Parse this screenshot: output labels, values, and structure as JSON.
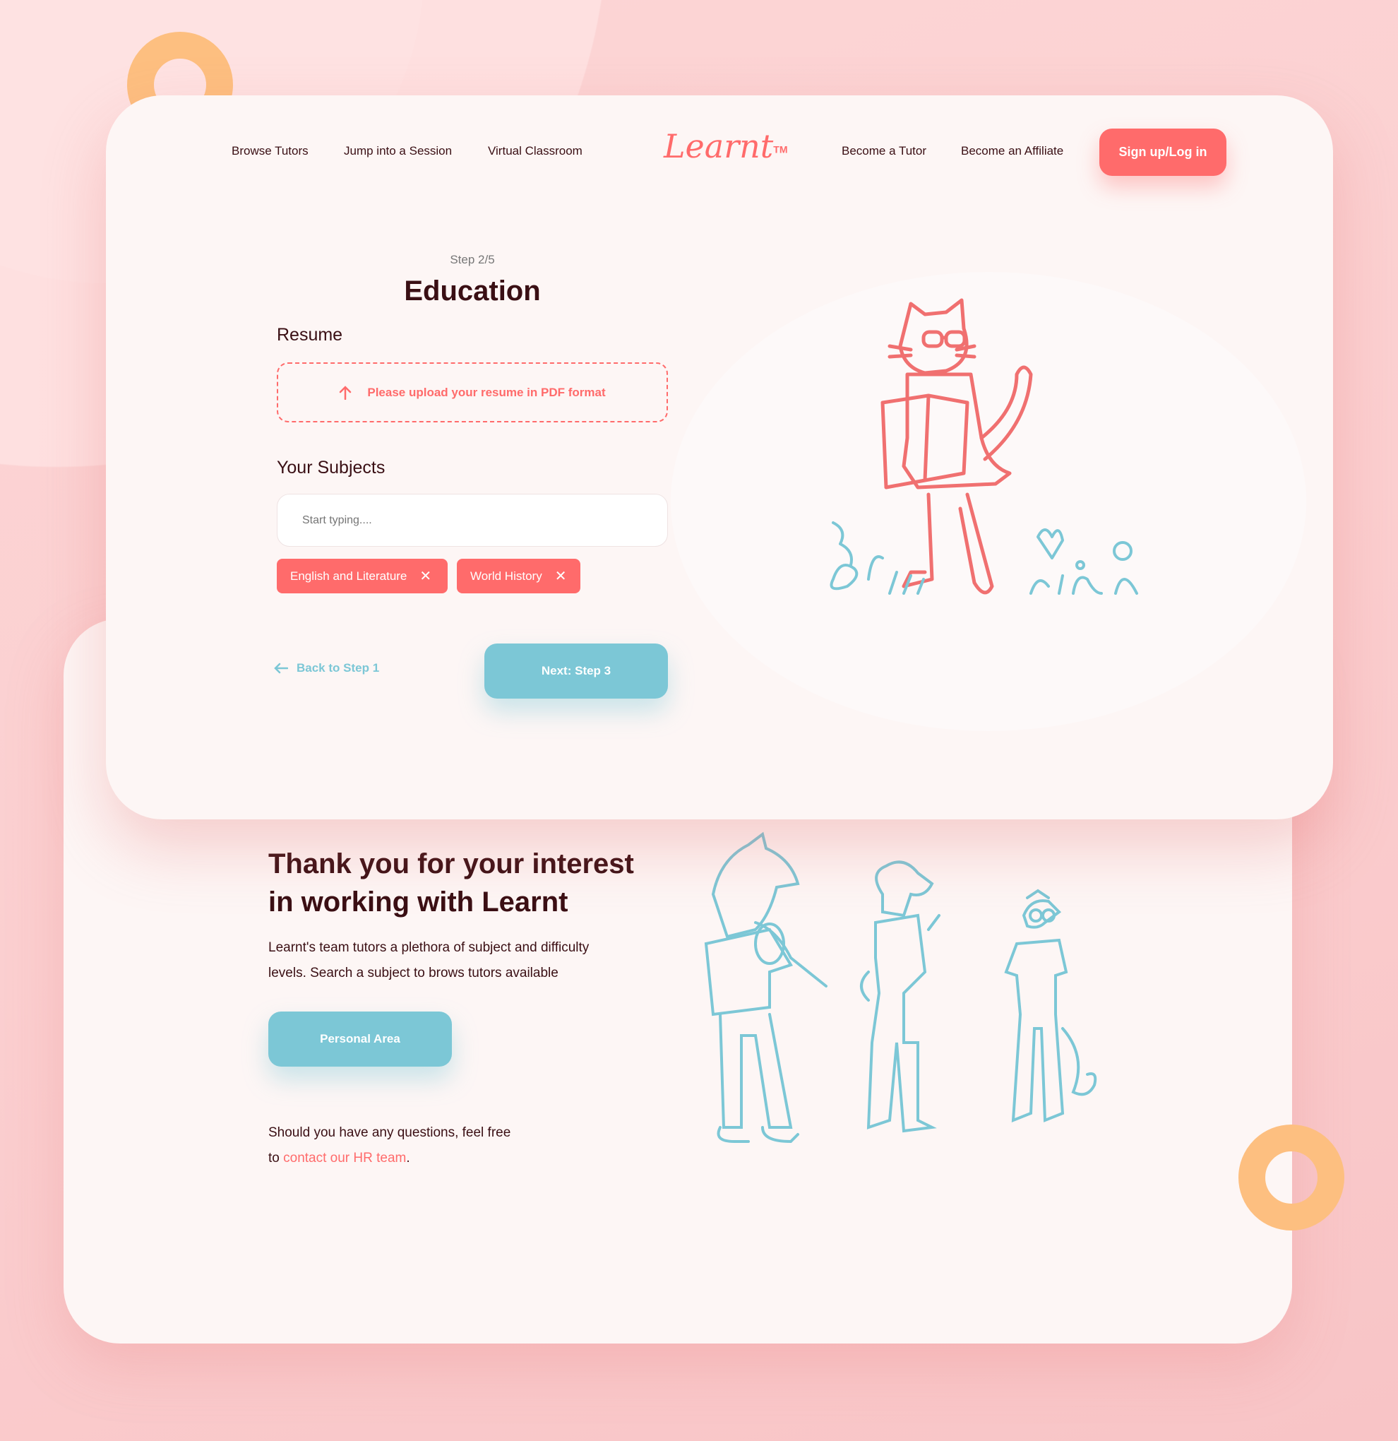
{
  "nav": {
    "left": [
      "Browse Tutors",
      "Jump into a Session",
      "Virtual Classroom"
    ],
    "logo": "Learnt",
    "logo_tm": "TM",
    "right": [
      "Become a Tutor",
      "Become an Affiliate"
    ],
    "signup": "Sign up/Log in"
  },
  "form": {
    "step": "Step 2/5",
    "title": "Education",
    "resume_label": "Resume",
    "upload_text": "Please upload your resume in PDF format",
    "subjects_label": "Your Subjects",
    "subjects_placeholder": "Start typing....",
    "chips": [
      "English and Literature",
      "World History"
    ],
    "back": "Back to Step 1",
    "next": "Next: Step 3"
  },
  "thanks": {
    "heading_line1": "Thank you for your interest",
    "heading_line2": "in working with Learnt",
    "body_line1": "Learnt's team tutors a plethora of subject and difficulty",
    "body_line2": "levels. Search a subject to brows tutors available",
    "button": "Personal Area",
    "questions_line1": "Should you have any questions, feel free",
    "questions_prefix": "to ",
    "contact_link": "contact our HR team",
    "questions_suffix": "."
  },
  "colors": {
    "accent": "#ff6b6b",
    "teal": "#7cc7d6",
    "text": "#3a0f14",
    "ring": "#fdbf80"
  }
}
